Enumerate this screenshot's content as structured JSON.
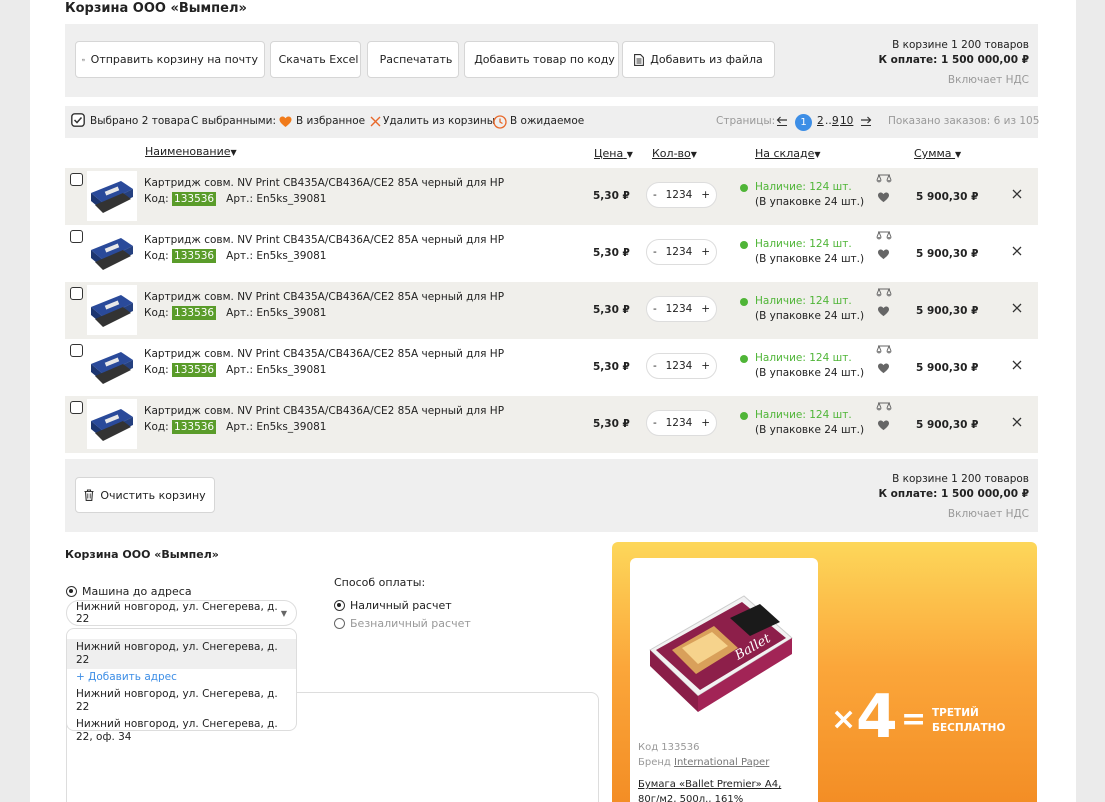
{
  "cart": {
    "title": "Корзина ООО «Вымпел»",
    "toolbar": [
      {
        "label": "Отправить корзину на почту",
        "icon": "envelope-icon"
      },
      {
        "label": "Скачать Excel",
        "icon": "download-icon"
      },
      {
        "label": "Распечатать",
        "icon": "printer-icon"
      },
      {
        "label": "Добавить товар по коду",
        "icon": "plus-icon"
      },
      {
        "label": "Добавить из файла",
        "icon": "file-icon"
      }
    ],
    "summary": {
      "in_cart": "В корзине 1 200 товаров",
      "to_pay": "К оплате: 1 500 000,00 ₽",
      "vat": "Включает НДС"
    }
  },
  "selection": {
    "selected": "Выбрано 2 товара",
    "with_selected": "С выбранными:",
    "favorite": "В избранное",
    "remove": "Удалить из корзины",
    "expected": "В ожидаемое",
    "pages_label": "Страницы:",
    "pages": [
      "1",
      "2",
      "...",
      "9",
      "10"
    ],
    "current_page": "1",
    "shown": "Показано заказов: 6 из 105"
  },
  "columns": {
    "name": "Наименование",
    "price": "Цена",
    "qty": "Кол-во",
    "stock": "На складе",
    "sum": "Сумма"
  },
  "rows": [
    {
      "name": "Картридж совм. NV Print  CB435A/CB436A/CE2 85A черный для HP",
      "code_label": "Код:",
      "code": "133536",
      "art": "Арт.: En5ks_39081",
      "price": "5,30 ₽",
      "qty": "1234",
      "avail": "Наличие: 124 шт.",
      "pack": "(В упаковке 24 шт.)",
      "sum": "5 900,30 ₽"
    },
    {
      "name": "Картридж совм. NV Print  CB435A/CB436A/CE2 85A черный для HP",
      "code_label": "Код:",
      "code": "133536",
      "art": "Арт.: En5ks_39081",
      "price": "5,30 ₽",
      "qty": "1234",
      "avail": "Наличие: 124 шт.",
      "pack": "(В упаковке 24 шт.)",
      "sum": "5 900,30 ₽"
    },
    {
      "name": "Картридж совм. NV Print  CB435A/CB436A/CE2 85A черный для HP",
      "code_label": "Код:",
      "code": "133536",
      "art": "Арт.: En5ks_39081",
      "price": "5,30 ₽",
      "qty": "1234",
      "avail": "Наличие: 124 шт.",
      "pack": "(В упаковке 24 шт.)",
      "sum": "5 900,30 ₽"
    },
    {
      "name": "Картридж совм. NV Print  CB435A/CB436A/CE2 85A черный для HP",
      "code_label": "Код:",
      "code": "133536",
      "art": "Арт.: En5ks_39081",
      "price": "5,30 ₽",
      "qty": "1234",
      "avail": "Наличие: 124 шт.",
      "pack": "(В упаковке 24 шт.)",
      "sum": "5 900,30 ₽"
    },
    {
      "name": "Картридж совм. NV Print  CB435A/CB436A/CE2 85A черный для HP",
      "code_label": "Код:",
      "code": "133536",
      "art": "Арт.: En5ks_39081",
      "price": "5,30 ₽",
      "qty": "1234",
      "avail": "Наличие: 124 шт.",
      "pack": "(В упаковке 24 шт.)",
      "sum": "5 900,30 ₽"
    }
  ],
  "bottom": {
    "clear": "Очистить корзину"
  },
  "delivery": {
    "title": "Корзина ООО «Вымпел»",
    "method": "Машина до адреса",
    "selected_address": "Нижний новгород, ул. Снегерева, д. 22",
    "options": [
      "Нижний новгород, ул. Снегерева, д. 22",
      "+ Добавить адрес",
      "Нижний новгород, ул. Снегерева, д. 22",
      "Нижний новгород, ул. Снегерева, д. 22, оф. 34"
    ],
    "payment_label": "Способ оплаты:",
    "cash": "Наличный расчет",
    "cashless": "Безналичный расчет"
  },
  "promo": {
    "code": "Код 133536",
    "brand_label": "Бренд",
    "brand": "International Paper",
    "title_line1": "Бумага «Ballet Premier» А4,",
    "title_line2": "80г/м2, 500л., 161%",
    "times": "×",
    "count": "4",
    "eq": "=",
    "third_line1": "ТРЕТИЙ",
    "third_line2": "БЕСПЛАТНО"
  },
  "colors": {
    "accent": "#3d8ee6",
    "code_badge": "#5a9c2a",
    "in_stock": "#4fb537",
    "favorite": "#f07a1a",
    "delete": "#e8682a"
  }
}
